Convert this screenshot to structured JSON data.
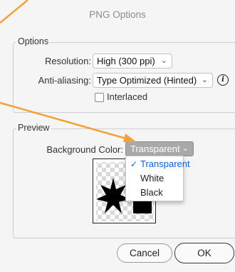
{
  "dialog": {
    "title": "PNG Options"
  },
  "options": {
    "legend": "Options",
    "resolution_label": "Resolution:",
    "resolution_value": "High (300 ppi)",
    "antialias_label": "Anti-aliasing:",
    "antialias_value": "Type Optimized (Hinted)",
    "interlaced_label": "Interlaced",
    "interlaced_checked": false
  },
  "preview": {
    "legend": "Preview",
    "bg_label": "Background Color:",
    "bg_value": "Transparent",
    "menu_items": [
      {
        "label": "Transparent",
        "selected": true
      },
      {
        "label": "White",
        "selected": false
      },
      {
        "label": "Black",
        "selected": false
      }
    ]
  },
  "buttons": {
    "cancel": "Cancel",
    "ok": "OK"
  },
  "colors": {
    "arrow": "#f4a13a",
    "accent": "#0a5fd3",
    "menu_bg": "#ffffff",
    "dropdown_active": "#a9a9a9"
  }
}
